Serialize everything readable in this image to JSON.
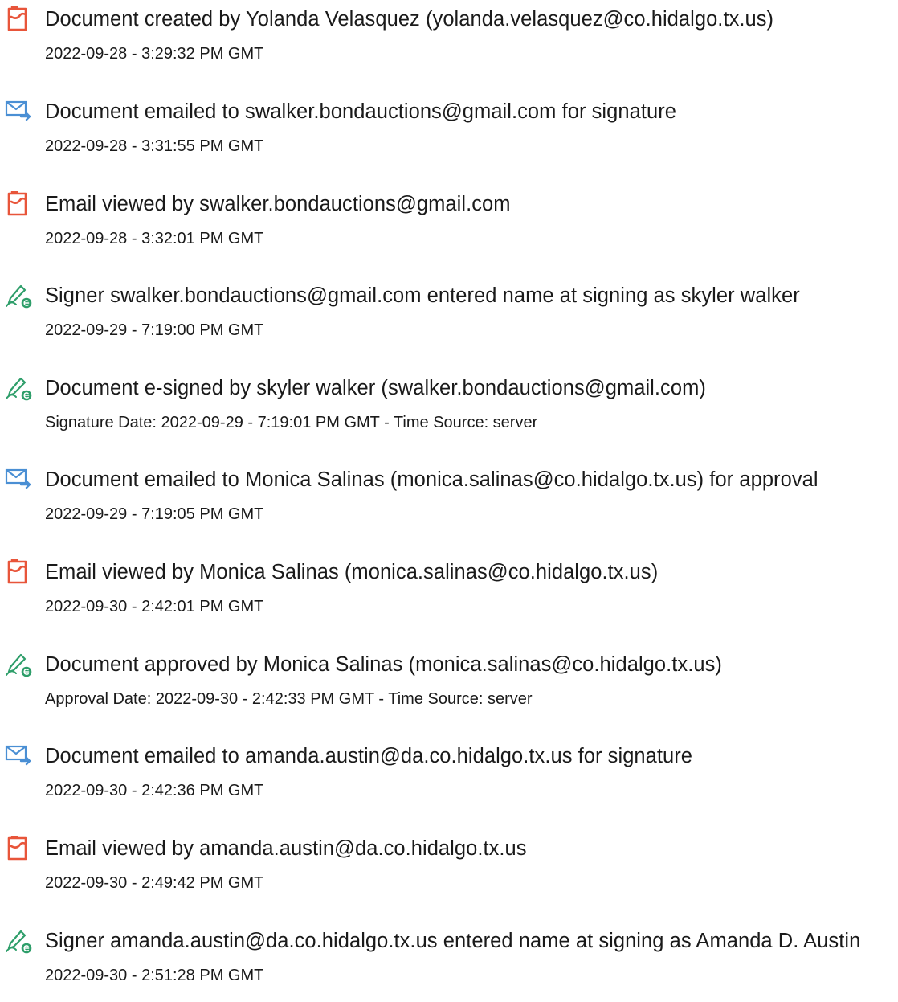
{
  "events": [
    {
      "icon": "document-created-icon",
      "title": "Document created by Yolanda Velasquez (yolanda.velasquez@co.hidalgo.tx.us)",
      "detail": "2022-09-28 - 3:29:32 PM GMT"
    },
    {
      "icon": "email-sent-icon",
      "title": "Document emailed to swalker.bondauctions@gmail.com for signature",
      "detail": "2022-09-28 - 3:31:55 PM GMT"
    },
    {
      "icon": "document-viewed-icon",
      "title": "Email viewed by swalker.bondauctions@gmail.com",
      "detail": "2022-09-28 - 3:32:01 PM GMT"
    },
    {
      "icon": "signature-pen-icon",
      "title": "Signer swalker.bondauctions@gmail.com entered name at signing as skyler walker",
      "detail": "2022-09-29 - 7:19:00 PM GMT"
    },
    {
      "icon": "signature-pen-icon",
      "title": "Document e-signed by skyler walker (swalker.bondauctions@gmail.com)",
      "detail": "Signature Date: 2022-09-29 - 7:19:01 PM GMT - Time Source: server"
    },
    {
      "icon": "email-sent-icon",
      "title": "Document emailed to Monica Salinas (monica.salinas@co.hidalgo.tx.us) for approval",
      "detail": "2022-09-29 - 7:19:05 PM GMT"
    },
    {
      "icon": "document-viewed-icon",
      "title": "Email viewed by Monica Salinas (monica.salinas@co.hidalgo.tx.us)",
      "detail": "2022-09-30 - 2:42:01 PM GMT"
    },
    {
      "icon": "signature-pen-icon",
      "title": "Document approved by Monica Salinas (monica.salinas@co.hidalgo.tx.us)",
      "detail": "Approval Date: 2022-09-30 - 2:42:33 PM GMT - Time Source: server"
    },
    {
      "icon": "email-sent-icon",
      "title": "Document emailed to amanda.austin@da.co.hidalgo.tx.us for signature",
      "detail": "2022-09-30 - 2:42:36 PM GMT"
    },
    {
      "icon": "document-viewed-icon",
      "title": "Email viewed by amanda.austin@da.co.hidalgo.tx.us",
      "detail": "2022-09-30 - 2:49:42 PM GMT"
    },
    {
      "icon": "signature-pen-icon",
      "title": "Signer amanda.austin@da.co.hidalgo.tx.us entered name at signing as Amanda D. Austin",
      "detail": "2022-09-30 - 2:51:28 PM GMT"
    }
  ],
  "colors": {
    "document_icon": "#e8553a",
    "email_icon": "#4a8fd4",
    "signature_icon": "#2e9e6a"
  }
}
